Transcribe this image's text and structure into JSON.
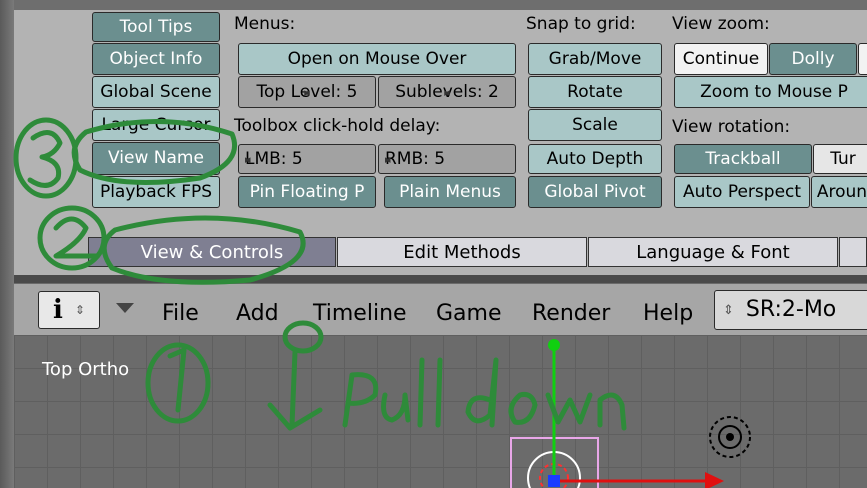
{
  "prefs": {
    "col1": [
      "Tool Tips",
      "Object Info",
      "Global Scene",
      "Large Cursor",
      "View Name",
      "Playback FPS"
    ],
    "menus_label": "Menus:",
    "open_on_mouse_over": "Open on Mouse Over",
    "top_level": "Top Level: 5",
    "sublevels": "Sublevels: 2",
    "toolbox_label": "Toolbox click-hold delay:",
    "lmb": "LMB: 5",
    "rmb": "RMB: 5",
    "pin_floating": "Pin Floating P",
    "plain_menus": "Plain Menus",
    "snap_label": "Snap to grid:",
    "grab_move": "Grab/Move",
    "rotate": "Rotate",
    "scale": "Scale",
    "auto_depth": "Auto Depth",
    "global_pivot": "Global Pivot",
    "view_zoom_label": "View zoom:",
    "continue": "Continue",
    "dolly": "Dolly",
    "zoom_to_mouse": "Zoom to Mouse P",
    "view_rotation_label": "View rotation:",
    "trackball": "Trackball",
    "turntable": "Tur",
    "auto_perspective": "Auto Perspect",
    "around": "Aroun"
  },
  "tabs": [
    "View & Controls",
    "Edit Methods",
    "Language & Font"
  ],
  "header": {
    "menus": [
      "File",
      "Add",
      "Timeline",
      "Game",
      "Render",
      "Help"
    ],
    "screen": "SR:2-Mo"
  },
  "viewport": {
    "label": "Top Ortho"
  },
  "colors": {
    "annotation": "#2e8b3a",
    "x_axis": "#e01010",
    "y_axis": "#10d010"
  }
}
